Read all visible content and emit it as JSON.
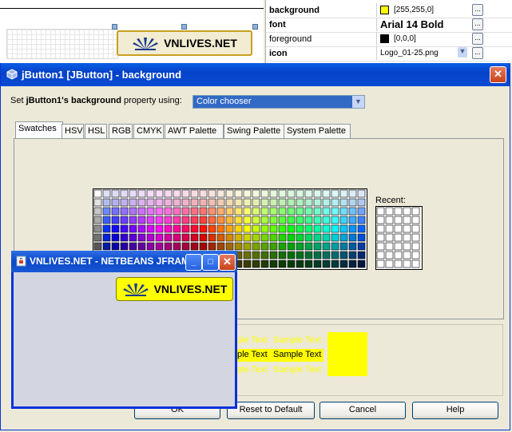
{
  "colors": {
    "accent": "#0831d9",
    "button_yellow": "#ffff00",
    "selection": "#316ac5"
  },
  "designer": {
    "button_text": "VNLIVES.NET"
  },
  "properties": [
    {
      "name": "background",
      "value": "[255,255,0]",
      "swatch": "#ffff00",
      "edit": "..."
    },
    {
      "name": "font",
      "value": "Arial 14 Bold",
      "edit": "..."
    },
    {
      "name": "foreground",
      "value": "[0,0,0]",
      "swatch": "#000000",
      "edit": "..."
    },
    {
      "name": "icon",
      "value": "Logo_01-25.png",
      "edit": "..."
    }
  ],
  "dialog": {
    "title": "jButton1 [JButton] - background",
    "set_prefix": "Set ",
    "set_bold": "jButton1's background",
    "set_suffix": " property using:",
    "property_select_value": "Color chooser",
    "tabs": [
      "Swatches",
      "HSV",
      "HSL",
      "RGB",
      "CMYK",
      "AWT Palette",
      "Swing Palette",
      "System Palette"
    ],
    "recent_label": "Recent:",
    "sample_text": "Sample Text",
    "sample_partial": "ple Text",
    "buttons": {
      "ok": "OK",
      "reset": "Reset to Default",
      "cancel": "Cancel",
      "help": "Help"
    }
  },
  "jframe": {
    "title": "VNLIVES.NET - NETBEANS JFRAME",
    "button_text": "VNLIVES.NET"
  }
}
